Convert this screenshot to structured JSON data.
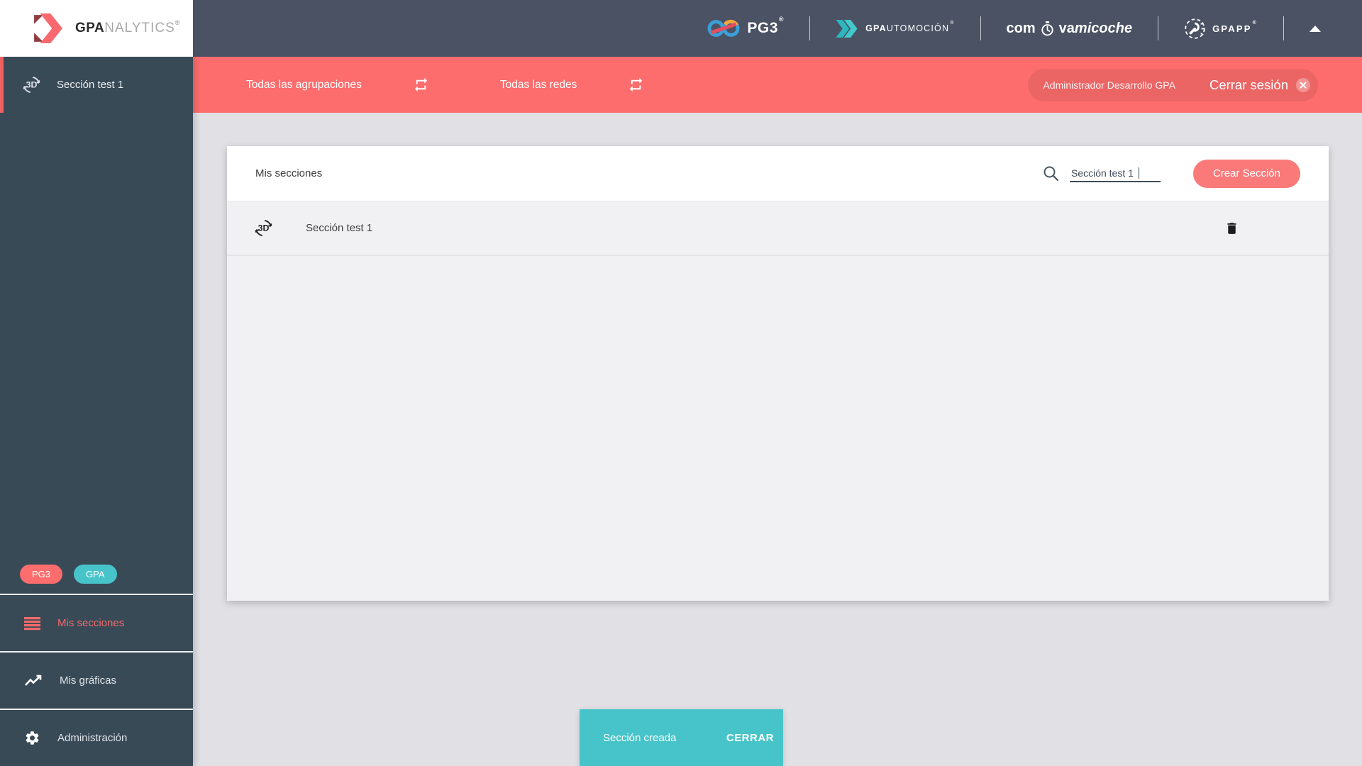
{
  "colors": {
    "accent": "#fd6d6d",
    "teal": "#47c4c9",
    "header_bg": "#4a5263",
    "sidebar_bg": "#394a57"
  },
  "logo": {
    "bold": "GPA",
    "light": "NALYTICS",
    "reg": "®"
  },
  "top_nav": {
    "pg3_text": "PG3",
    "pg3_reg": "®",
    "gpautomocion_bold": "GPA",
    "gpautomocion_rest": "UTOMOCIÓN",
    "gpautomocion_reg": "®",
    "coche_pre": "com",
    "coche_mid": "va",
    "coche_tail": "micoche",
    "gpapp_text": "GPAPP",
    "gpapp_reg": "®"
  },
  "filter_bar": {
    "groups_label": "Todas las agrupaciones",
    "networks_label": "Todas las redes",
    "user_name": "Administrador Desarrollo GPA",
    "logout_label": "Cerrar sesión"
  },
  "sidebar": {
    "active_item": "Sección test 1",
    "badges": [
      {
        "label": "PG3"
      },
      {
        "label": "GPA"
      }
    ],
    "menu": [
      {
        "label": "Mis secciones"
      },
      {
        "label": "Mis gráficas"
      },
      {
        "label": "Administración"
      }
    ]
  },
  "content": {
    "title": "Mis secciones",
    "search_value": "Sección test 1",
    "create_button": "Crear Sección",
    "rows": [
      {
        "label": "Sección test 1"
      }
    ]
  },
  "toast": {
    "message": "Sección creada",
    "action": "CERRAR"
  }
}
